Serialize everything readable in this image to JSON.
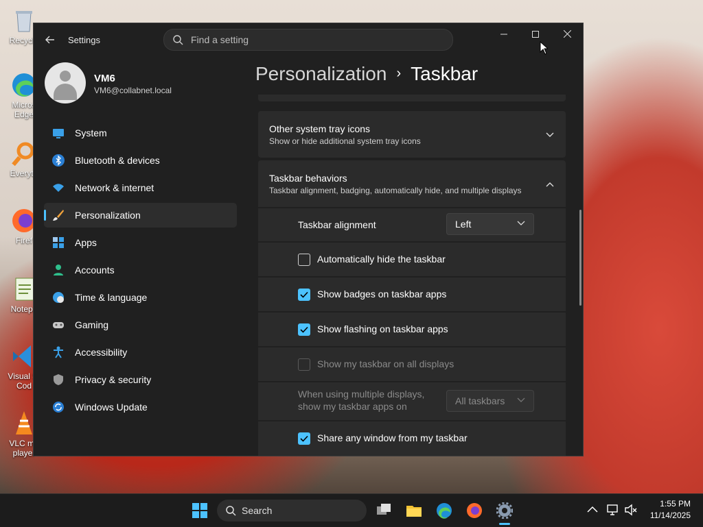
{
  "desktop": {
    "icons": [
      {
        "label": "Recycle",
        "icon": "recycle-bin-icon"
      },
      {
        "label": "Micros Edge",
        "icon": "edge-icon"
      },
      {
        "label": "Everyth",
        "icon": "everything-icon"
      },
      {
        "label": "Firef",
        "icon": "firefox-icon"
      },
      {
        "label": "Notepa",
        "icon": "notepad-icon"
      },
      {
        "label": "Visual St Cod",
        "icon": "vscode-icon"
      },
      {
        "label": "VLC me player",
        "icon": "vlc-icon"
      }
    ]
  },
  "window": {
    "title": "Settings",
    "search_placeholder": "Find a setting",
    "controls": {
      "minimize": "—",
      "maximize": "☐",
      "close": "✕"
    }
  },
  "profile": {
    "name": "VM6",
    "email": "VM6@collabnet.local"
  },
  "nav": {
    "items": [
      {
        "label": "System",
        "icon": "monitor-icon"
      },
      {
        "label": "Bluetooth & devices",
        "icon": "bluetooth-icon"
      },
      {
        "label": "Network & internet",
        "icon": "wifi-icon"
      },
      {
        "label": "Personalization",
        "icon": "brush-icon",
        "active": true
      },
      {
        "label": "Apps",
        "icon": "apps-icon"
      },
      {
        "label": "Accounts",
        "icon": "accounts-icon"
      },
      {
        "label": "Time & language",
        "icon": "globe-clock-icon"
      },
      {
        "label": "Gaming",
        "icon": "gamepad-icon"
      },
      {
        "label": "Accessibility",
        "icon": "accessibility-icon"
      },
      {
        "label": "Privacy & security",
        "icon": "shield-icon"
      },
      {
        "label": "Windows Update",
        "icon": "update-icon"
      }
    ]
  },
  "breadcrumb": {
    "parent": "Personalization",
    "separator": "›",
    "current": "Taskbar"
  },
  "sections": {
    "tray": {
      "title": "Other system tray icons",
      "subtitle": "Show or hide additional system tray icons",
      "expanded": false
    },
    "behaviors": {
      "title": "Taskbar behaviors",
      "subtitle": "Taskbar alignment, badging, automatically hide, and multiple displays",
      "expanded": true
    }
  },
  "settings": {
    "alignment": {
      "label": "Taskbar alignment",
      "value": "Left"
    },
    "autohide": {
      "label": "Automatically hide the taskbar",
      "checked": false
    },
    "badges": {
      "label": "Show badges on taskbar apps",
      "checked": true
    },
    "flashing": {
      "label": "Show flashing on taskbar apps",
      "checked": true
    },
    "all_displays": {
      "label": "Show my taskbar on all displays",
      "checked": false,
      "disabled": true
    },
    "multi_display": {
      "label_line1": "When using multiple displays,",
      "label_line2": "show my taskbar apps on",
      "value": "All taskbars",
      "disabled": true
    },
    "share_window": {
      "label": "Share any window from my taskbar",
      "checked": true
    }
  },
  "taskbar": {
    "search_label": "Search",
    "apps": [
      "start-icon",
      "task-view-icon",
      "file-explorer-icon",
      "edge-icon",
      "firefox-icon",
      "settings-icon"
    ],
    "clock": {
      "time": "1:55 PM",
      "date": "11/14/2025"
    }
  },
  "colors": {
    "accent": "#4cc2ff",
    "window_bg": "#202020",
    "card_bg": "#2b2b2b"
  }
}
